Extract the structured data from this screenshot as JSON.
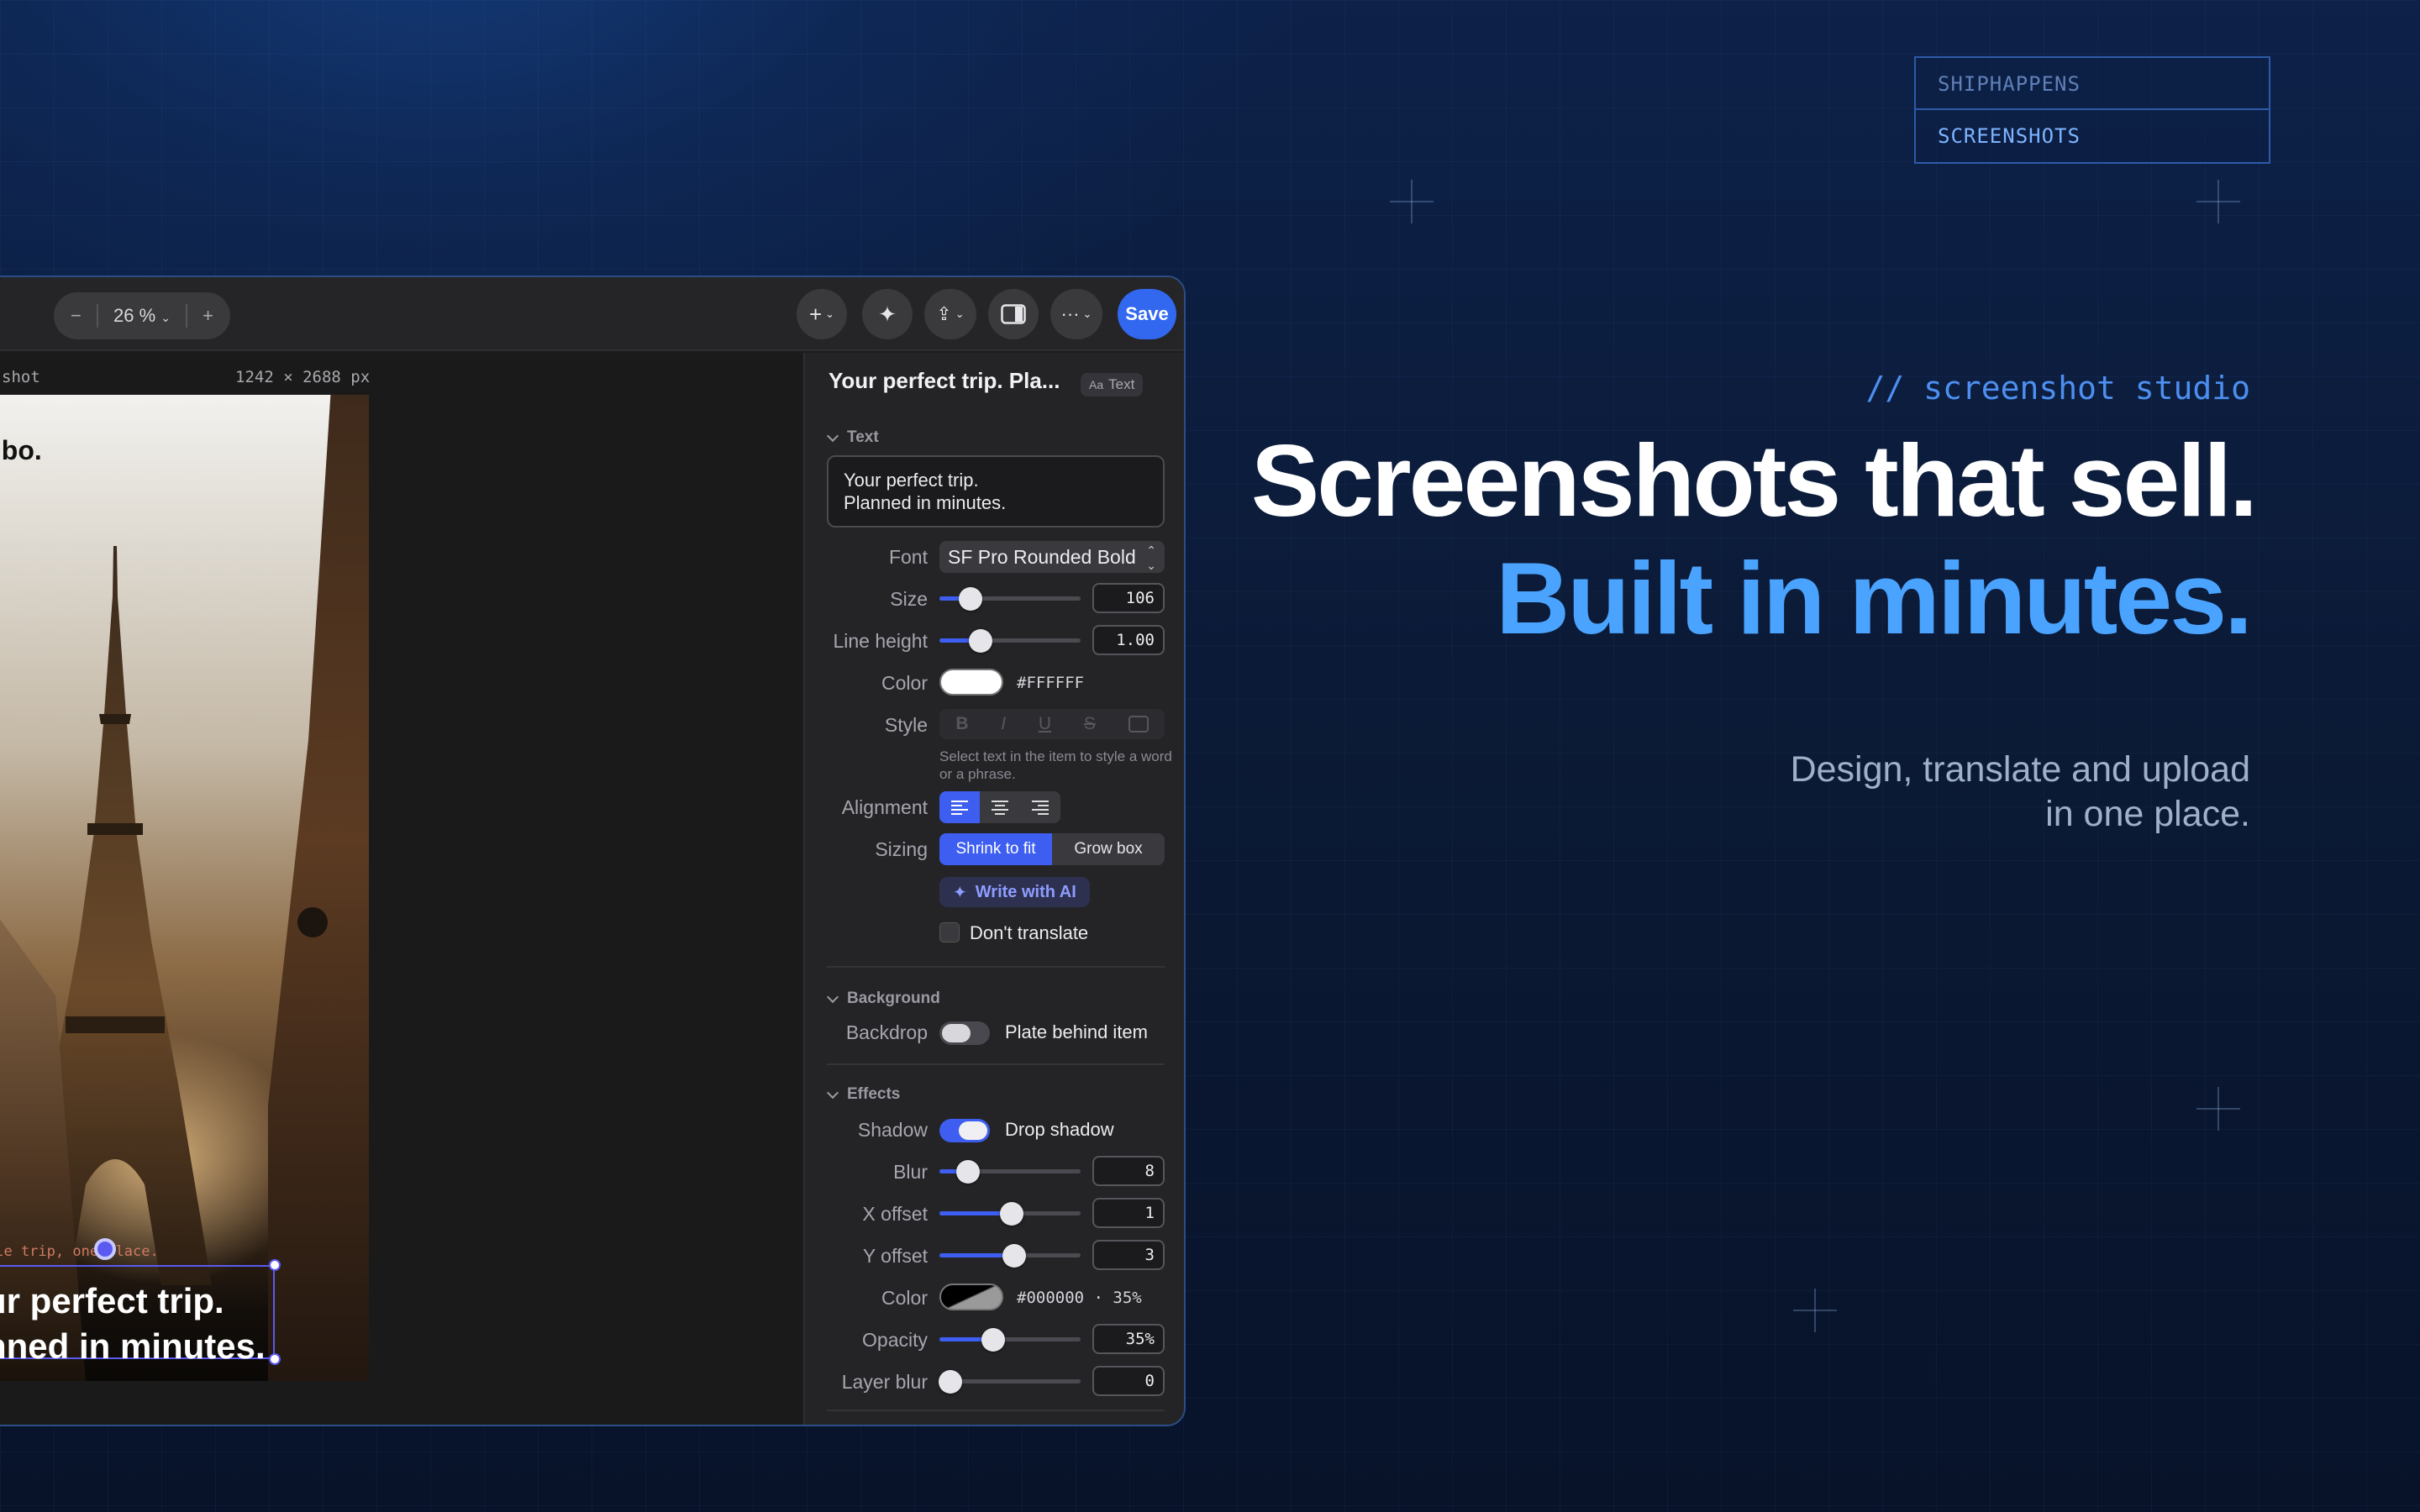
{
  "brand": {
    "line1": "SHIPHAPPENS",
    "line2": "SCREENSHOTS"
  },
  "hero": {
    "kicker": "// screenshot studio",
    "headline": "Screenshots that sell.",
    "headline_accent": "Built in minutes.",
    "subline1": "Design, translate and upload",
    "subline2": "in one place."
  },
  "colors": {
    "accent": "#3268f0",
    "headline_accent": "#4aa3ff",
    "selection": "#5a5af0"
  },
  "toolbar": {
    "zoom_minus": "−",
    "zoom_value": "26 %",
    "zoom_plus": "+",
    "add_label": "+",
    "more_label": "···",
    "save_label": "Save"
  },
  "canvas": {
    "screenshot_label": "shot",
    "dimensions": "1242 × 2688 px",
    "phone_logo": "ilbo.",
    "selection_caption": "ole trip, one place.",
    "headline_line1": "ur perfect trip.",
    "headline_line2": "nned in minutes."
  },
  "inspector": {
    "title": "Your perfect trip. Pla...",
    "badge": "Text",
    "badge_icon": "Aa",
    "text_section": {
      "header": "Text",
      "content_line1": "Your perfect trip.",
      "content_line2": "Planned in minutes.",
      "font_label": "Font",
      "font_value": "SF Pro Rounded Bold",
      "size_label": "Size",
      "size_value": "106",
      "size_level": 0.22,
      "line_height_label": "Line height",
      "line_height_value": "1.00",
      "line_height_level": 0.29,
      "color_label": "Color",
      "color_value": "#FFFFFF",
      "style_label": "Style",
      "style_bold": "B",
      "style_italic": "I",
      "style_underline": "U",
      "style_strike": "S",
      "style_hint": "Select text in the item to style a word or a phrase.",
      "alignment_label": "Alignment",
      "sizing_label": "Sizing",
      "sizing_shrink": "Shrink to fit",
      "sizing_grow": "Grow box",
      "write_ai": "Write with AI",
      "dont_translate": "Don't translate"
    },
    "background_section": {
      "header": "Background",
      "backdrop_label": "Backdrop",
      "backdrop_toggle": "Plate behind item",
      "backdrop_on": false
    },
    "effects_section": {
      "header": "Effects",
      "shadow_label": "Shadow",
      "shadow_toggle": "Drop shadow",
      "shadow_on": true,
      "blur_label": "Blur",
      "blur_value": "8",
      "blur_level": 0.2,
      "x_offset_label": "X offset",
      "x_offset_value": "1",
      "x_offset_level": 0.51,
      "y_offset_label": "Y offset",
      "y_offset_value": "3",
      "y_offset_level": 0.53,
      "color_label": "Color",
      "color_value": "#000000 · 35%",
      "opacity_label": "Opacity",
      "opacity_value": "35%",
      "opacity_level": 0.38,
      "layer_blur_label": "Layer blur",
      "layer_blur_value": "0",
      "layer_blur_level": 0.08
    }
  }
}
